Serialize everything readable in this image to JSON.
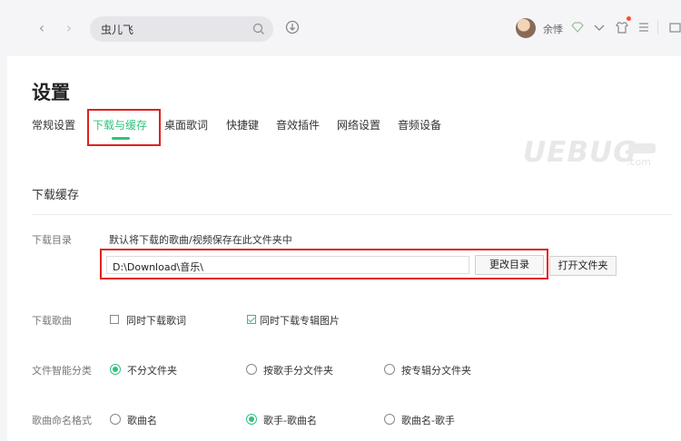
{
  "header": {
    "search": {
      "value": "虫儿飞"
    },
    "user": {
      "name": "余悸"
    }
  },
  "settings": {
    "title": "设置",
    "tabs": [
      {
        "label": "常规设置"
      },
      {
        "label": "下载与缓存",
        "active": true
      },
      {
        "label": "桌面歌词"
      },
      {
        "label": "快捷键"
      },
      {
        "label": "音效插件"
      },
      {
        "label": "网络设置"
      },
      {
        "label": "音频设备"
      }
    ],
    "section_title": "下载缓存",
    "download_dir": {
      "label": "下载目录",
      "description": "默认将下载的歌曲/视频保存在此文件夹中",
      "path": "D:\\Download\\音乐\\",
      "change_button": "更改目录",
      "open_button": "打开文件夹"
    },
    "download_song": {
      "label": "下载歌曲",
      "options": [
        {
          "label": "同时下载歌词",
          "checked": false
        },
        {
          "label": "同时下载专辑图片",
          "checked": true
        }
      ]
    },
    "smart_folder": {
      "label": "文件智能分类",
      "options": [
        {
          "label": "不分文件夹",
          "selected": true
        },
        {
          "label": "按歌手分文件夹",
          "selected": false
        },
        {
          "label": "按专辑分文件夹",
          "selected": false
        }
      ]
    },
    "naming_format": {
      "label": "歌曲命名格式",
      "options": [
        {
          "label": "歌曲名",
          "selected": false
        },
        {
          "label": "歌手-歌曲名",
          "selected": true
        },
        {
          "label": "歌曲名-歌手",
          "selected": false
        }
      ]
    }
  },
  "watermark": {
    "text": "UEBUG",
    "suffix": ".com"
  },
  "colors": {
    "accent": "#31c27c",
    "highlight_box": "#e02020"
  }
}
